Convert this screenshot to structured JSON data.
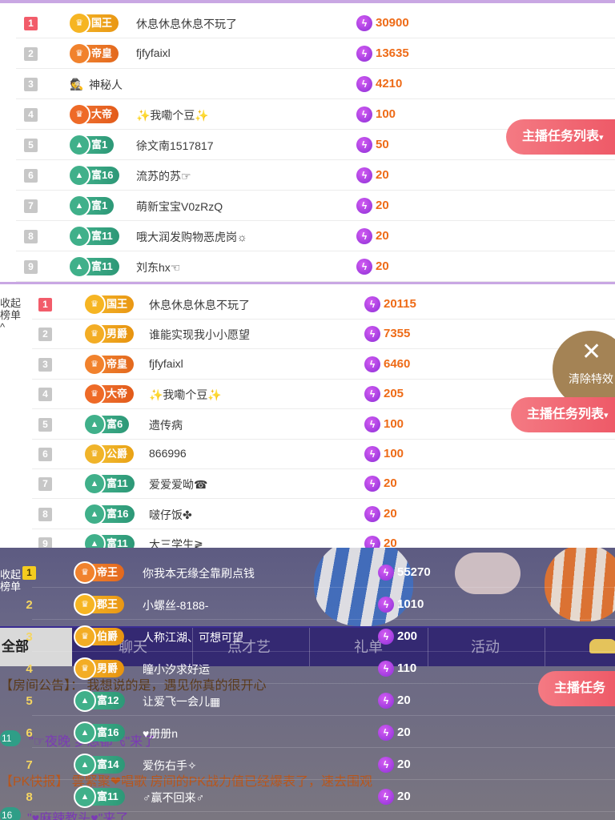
{
  "panel1": {
    "task_button": "主播任务列表",
    "rows": [
      {
        "rank": "1",
        "badge": "国王",
        "level": "king",
        "name": "休息休息休息不玩了",
        "score": "30900"
      },
      {
        "rank": "2",
        "badge": "帝皇",
        "level": "emp",
        "name": "fjfyfaixl",
        "score": "13635"
      },
      {
        "rank": "3",
        "badge": "",
        "level": "mystery",
        "name": "神秘人",
        "score": "4210"
      },
      {
        "rank": "4",
        "badge": "大帝",
        "level": "dadi",
        "name": "✨我嘞个豆✨",
        "score": "100"
      },
      {
        "rank": "5",
        "badge": "富1",
        "level": "rich",
        "name": "徐文南1517817",
        "score": "50"
      },
      {
        "rank": "6",
        "badge": "富16",
        "level": "rich",
        "name": "流苏的苏☞",
        "score": "20"
      },
      {
        "rank": "7",
        "badge": "富1",
        "level": "rich",
        "name": "萌新宝宝V0zRzQ",
        "score": "20"
      },
      {
        "rank": "8",
        "badge": "富11",
        "level": "rich",
        "name": "哦大润发购物恶虎岗☼",
        "score": "20"
      },
      {
        "rank": "9",
        "badge": "富11",
        "level": "rich",
        "name": "刘东hx☜",
        "score": "20"
      }
    ]
  },
  "panel2": {
    "side_text": [
      "收起",
      "榜单",
      "^"
    ],
    "task_button": "主播任务列表",
    "clear_effects": "清除特效",
    "rows": [
      {
        "rank": "1",
        "badge": "国王",
        "level": "king",
        "name": "休息休息休息不玩了",
        "score": "20115"
      },
      {
        "rank": "2",
        "badge": "男爵",
        "level": "jun",
        "name": "谁能实现我小小愿望",
        "score": "7355"
      },
      {
        "rank": "3",
        "badge": "帝皇",
        "level": "emp",
        "name": "fjfyfaixl",
        "score": "6460"
      },
      {
        "rank": "4",
        "badge": "大帝",
        "level": "dadi",
        "name": "✨我嘞个豆✨",
        "score": "205"
      },
      {
        "rank": "5",
        "badge": "富6",
        "level": "rich",
        "name": "遗传病",
        "score": "100"
      },
      {
        "rank": "6",
        "badge": "公爵",
        "level": "duke",
        "name": "866996",
        "score": "100"
      },
      {
        "rank": "7",
        "badge": "富11",
        "level": "rich",
        "name": "爱爱爱呦☎",
        "score": "20"
      },
      {
        "rank": "8",
        "badge": "富16",
        "level": "rich",
        "name": "啵仔饭✤",
        "score": "20"
      },
      {
        "rank": "9",
        "badge": "富11",
        "level": "rich",
        "name": "大三学生≷",
        "score": "20"
      }
    ]
  },
  "panel3": {
    "side_text": [
      "收起",
      "榜单"
    ],
    "task_button": "主播任务",
    "nav": {
      "all": "全部",
      "tabs": [
        "聊天",
        "点才艺",
        "礼单",
        "活动"
      ]
    },
    "chat": [
      {
        "text": "【房间公告】： 我想说的是，遇见你真的很开心"
      },
      {
        "pill": "11",
        "text": "\"☞夜晚 梦想都飞\"来了"
      },
      {
        "text": "【PK快报】 雲緊聚❤唱歌 房间的PK战力值已经爆表了，速去围观"
      },
      {
        "pill": "16",
        "text": "\"♥麻辣教头♥\"来了"
      }
    ],
    "rows": [
      {
        "rank": "1",
        "badge": "帝王",
        "level": "emp",
        "name": "你我本无缘全靠刷点钱",
        "score": "55270"
      },
      {
        "rank": "2",
        "badge": "郡王",
        "level": "king",
        "name": "小螺丝-8188-",
        "score": "1010"
      },
      {
        "rank": "3",
        "badge": "伯爵",
        "level": "jun",
        "name": "人称江湖、可想可望",
        "score": "200"
      },
      {
        "rank": "4",
        "badge": "男爵",
        "level": "jun",
        "name": "瞳小汐求好运",
        "score": "110"
      },
      {
        "rank": "5",
        "badge": "富12",
        "level": "rich",
        "name": "让爱飞一会儿▦",
        "score": "20"
      },
      {
        "rank": "6",
        "badge": "富16",
        "level": "rich",
        "name": "♥册册n",
        "score": "20"
      },
      {
        "rank": "7",
        "badge": "富14",
        "level": "rich",
        "name": "爱伤右手✧",
        "score": "20"
      },
      {
        "rank": "8",
        "badge": "富11",
        "level": "rich",
        "name": "♂赢不回来♂",
        "score": "20"
      }
    ]
  },
  "icons": {
    "bolt": "lightning-icon",
    "crown": "crown-icon",
    "triangle": "rich-level-icon",
    "mystery": "mystery-person-icon",
    "close": "close-icon"
  }
}
